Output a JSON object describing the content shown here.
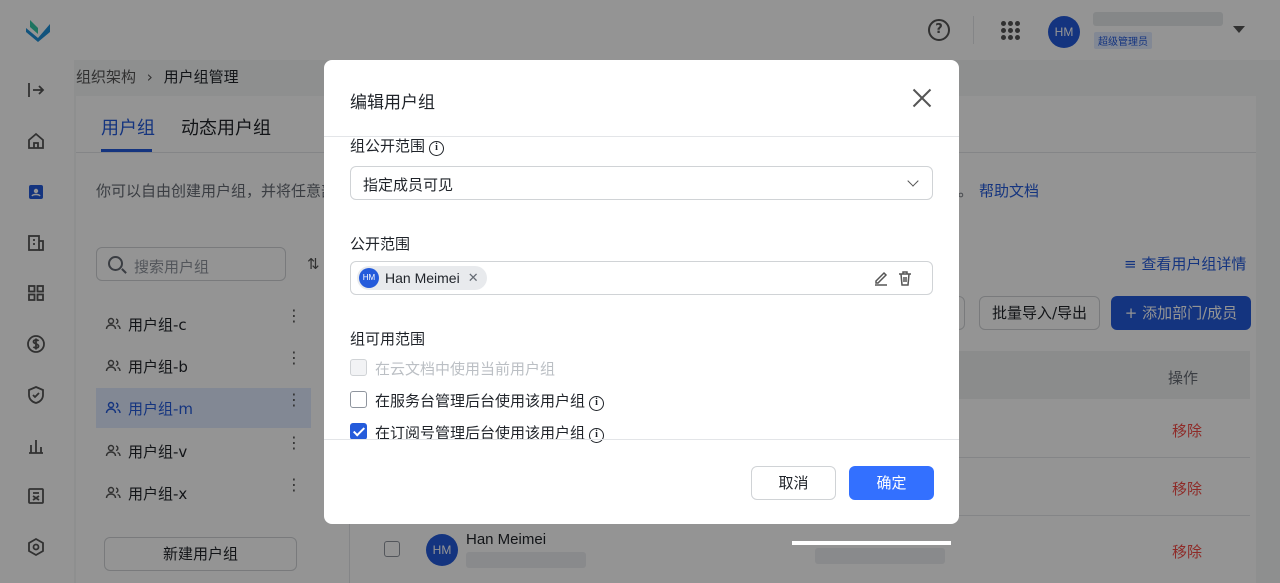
{
  "header": {
    "avatar_initials": "HM",
    "role_badge": "超级管理员",
    "help_icon": "question-circle-icon",
    "apps_icon": "grid-dots-icon"
  },
  "sidebar": {
    "icons": [
      "expand-icon",
      "home-icon",
      "contacts-icon",
      "building-icon",
      "apps-icon",
      "billing-icon",
      "shield-icon",
      "chart-icon",
      "calculator-icon",
      "settings-icon"
    ]
  },
  "breadcrumb": {
    "parent": "组织架构",
    "separator": "›",
    "current": "用户组管理"
  },
  "tabs": [
    {
      "label": "用户组",
      "active": true
    },
    {
      "label": "动态用户组",
      "active": false
    }
  ],
  "intro": {
    "text": "你可以自由创建用户组，并将任意部",
    "tail": "。",
    "help_link": "帮助文档"
  },
  "group_list": {
    "search_placeholder": "搜索用户组",
    "items": [
      {
        "label": "用户组-c",
        "active": false
      },
      {
        "label": "用户组-b",
        "active": false
      },
      {
        "label": "用户组-m",
        "active": true
      },
      {
        "label": "用户组-v",
        "active": false
      },
      {
        "label": "用户组-x",
        "active": false
      }
    ],
    "new_button": "新建用户组"
  },
  "main": {
    "detail_link": "查看用户组详情",
    "import_export_button": "批量导入/导出",
    "add_button": "+ 添加部门/成员",
    "column_operation": "操作",
    "remove_label": "移除",
    "rows": [
      {
        "remove": "移除"
      },
      {
        "remove": "移除"
      },
      {
        "avatar": "HM",
        "name": "Han Meimei",
        "remove": "移除"
      }
    ]
  },
  "modal": {
    "title": "编辑用户组",
    "visibility_label": "组公开范围",
    "visibility_value": "指定成员可见",
    "public_scope_label": "公开范围",
    "member_chip": {
      "avatar": "HM",
      "name": "Han Meimei"
    },
    "usable_scope_label": "组可用范围",
    "options": [
      {
        "label": "在云文档中使用当前用户组",
        "checked": false,
        "disabled": true
      },
      {
        "label": "在服务台管理后台使用该用户组",
        "checked": false,
        "disabled": false,
        "info": true
      },
      {
        "label": "在订阅号管理后台使用该用户组",
        "checked": true,
        "disabled": false,
        "info": true
      }
    ],
    "cancel": "取消",
    "confirm": "确定"
  },
  "colors": {
    "primary": "#245bdb",
    "confirm": "#3370ff",
    "danger": "#f54a45"
  }
}
